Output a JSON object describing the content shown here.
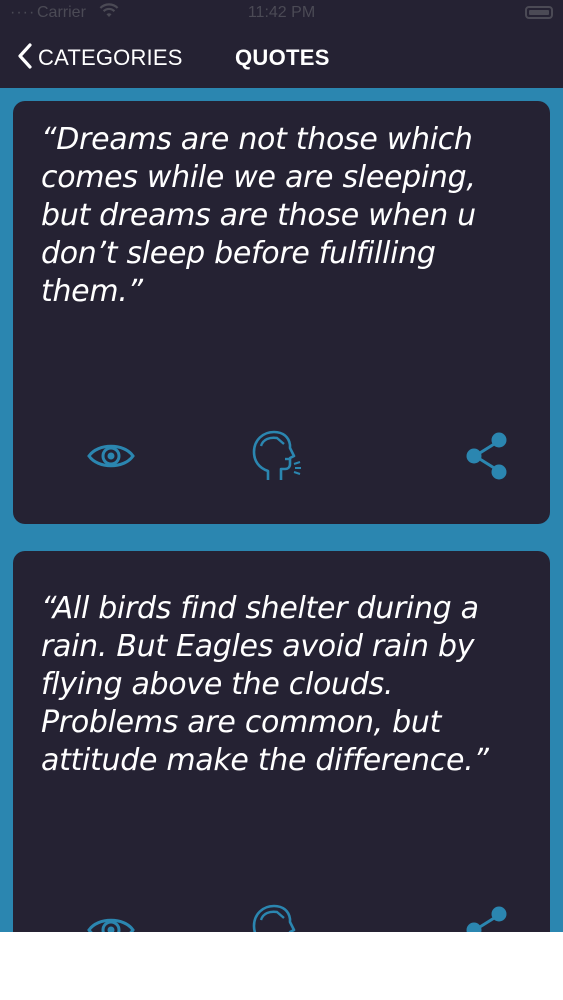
{
  "status_bar": {
    "carrier": "Carrier",
    "time": "11:42 PM"
  },
  "nav": {
    "back_label": "CATEGORIES",
    "title": "QUOTES"
  },
  "quotes": [
    {
      "text": "“Dreams are not those which comes while we are sleeping, but dreams are those when u don’t sleep before fulfilling them.”"
    },
    {
      "text": "“All birds find shelter during a rain. But Eagles avoid rain by flying above the clouds. Problems are common, but attitude make the difference.”"
    }
  ],
  "icons": {
    "view": "eye-icon",
    "speak": "speaking-head-icon",
    "share": "share-icon"
  },
  "colors": {
    "background": "#2b86b0",
    "card": "#252233",
    "icon": "#2b86b0",
    "text": "#ffffff"
  }
}
